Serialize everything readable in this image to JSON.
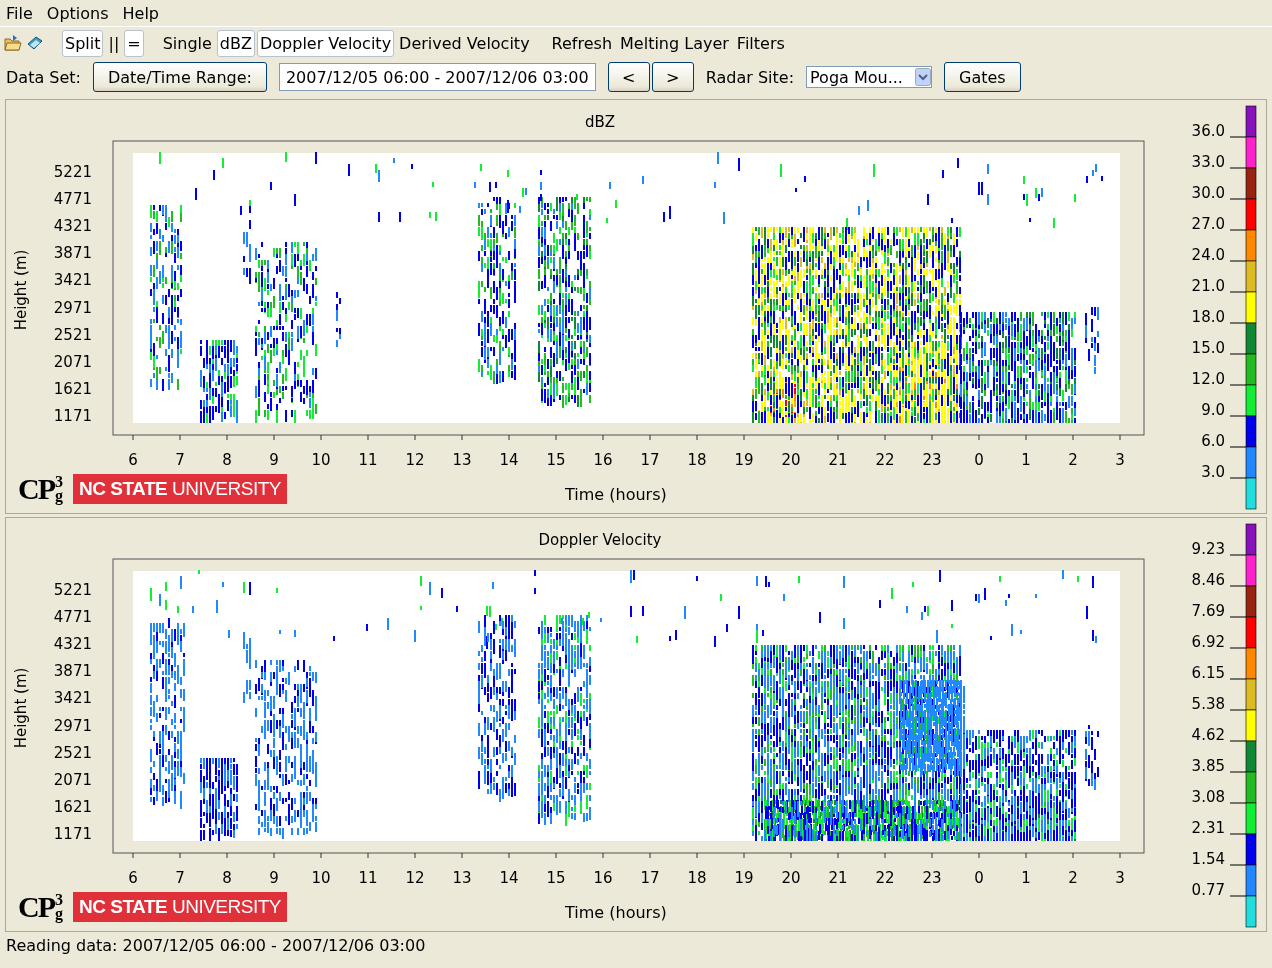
{
  "menu": [
    "File",
    "Options",
    "Help"
  ],
  "toolbar": {
    "items": [
      {
        "label": "Split",
        "selected": true
      },
      {
        "label": "||",
        "selected": false
      },
      {
        "label": "=",
        "selected": true
      },
      {
        "label": "Single",
        "selected": false
      },
      {
        "label": "dBZ",
        "selected": true
      },
      {
        "label": "Doppler Velocity",
        "selected": true
      },
      {
        "label": "Derived Velocity",
        "selected": false
      },
      {
        "label": "Refresh",
        "selected": false
      },
      {
        "label": "Melting Layer",
        "selected": false
      },
      {
        "label": "Filters",
        "selected": false
      }
    ]
  },
  "data_set": {
    "label": "Data Set:",
    "range_button": "Date/Time Range:",
    "range_value": "2007/12/05 06:00 - 2007/12/06 03:00",
    "prev": "<",
    "next": ">",
    "site_label": "Radar Site:",
    "site_value": "Poga Mou...",
    "gates": "Gates"
  },
  "panels": [
    {
      "title": "dBZ",
      "ylabel": "Height (m)",
      "xlabel": "Time (hours)",
      "yticks": [
        "5221",
        "4771",
        "4321",
        "3871",
        "3421",
        "2971",
        "2521",
        "2071",
        "1621",
        "1171"
      ],
      "xticks": [
        "6",
        "7",
        "8",
        "9",
        "10",
        "11",
        "12",
        "13",
        "14",
        "15",
        "16",
        "17",
        "18",
        "19",
        "20",
        "21",
        "22",
        "23",
        "0",
        "1",
        "2",
        "3"
      ],
      "logo": {
        "text": "CP",
        "upper": "3",
        "lower": "g"
      },
      "university": "**NC STATE** UNIVERSITY",
      "legend": {
        "labels": [
          "36.0",
          "33.0",
          "30.0",
          "27.0",
          "24.0",
          "21.0",
          "18.0",
          "15.0",
          "12.0",
          "9.0",
          "6.0",
          "3.0"
        ],
        "segments": [
          {
            "color": "#8811bb"
          },
          {
            "color": "#ff22cc"
          },
          {
            "color": "#992211"
          },
          {
            "color": "#ff0000"
          },
          {
            "color": "#ff8800"
          },
          {
            "color": "#ddbb22"
          },
          {
            "color": "#ffff00"
          },
          {
            "color": "#118833"
          },
          {
            "color": "#22bb22"
          },
          {
            "color": "#11ee33"
          },
          {
            "color": "#0000ee"
          },
          {
            "color": "#2288ff"
          },
          {
            "color": "#22dddd"
          }
        ]
      }
    },
    {
      "title": "Doppler Velocity",
      "ylabel": "Height (m)",
      "xlabel": "Time (hours)",
      "yticks": [
        "5221",
        "4771",
        "4321",
        "3871",
        "3421",
        "2971",
        "2521",
        "2071",
        "1621",
        "1171"
      ],
      "xticks": [
        "6",
        "7",
        "8",
        "9",
        "10",
        "11",
        "12",
        "13",
        "14",
        "15",
        "16",
        "17",
        "18",
        "19",
        "20",
        "21",
        "22",
        "23",
        "0",
        "1",
        "2",
        "3"
      ],
      "logo": {
        "text": "CP",
        "upper": "3",
        "lower": "g"
      },
      "university": "**NC STATE** UNIVERSITY",
      "legend": {
        "labels": [
          "9.23",
          "8.46",
          "7.69",
          "6.92",
          "6.15",
          "5.38",
          "4.62",
          "3.85",
          "3.08",
          "2.31",
          "1.54",
          "0.77"
        ],
        "segments": [
          {
            "color": "#8811bb"
          },
          {
            "color": "#ff22cc"
          },
          {
            "color": "#992211"
          },
          {
            "color": "#ff0000"
          },
          {
            "color": "#ff8800"
          },
          {
            "color": "#ddbb22"
          },
          {
            "color": "#ffff00"
          },
          {
            "color": "#118833"
          },
          {
            "color": "#22bb22"
          },
          {
            "color": "#11ee33"
          },
          {
            "color": "#0000ee"
          },
          {
            "color": "#2288ff"
          },
          {
            "color": "#22dddd"
          }
        ]
      }
    }
  ],
  "status_bar": "Reading data: 2007/12/05 06:00 - 2007/12/06 03:00"
}
